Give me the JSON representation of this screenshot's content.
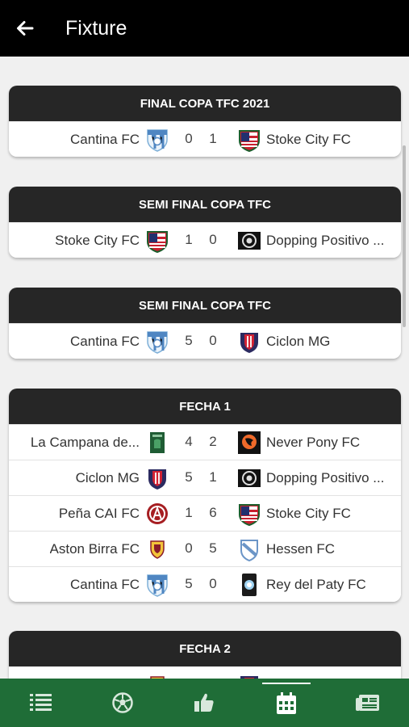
{
  "appbar": {
    "title": "Fixture",
    "back_icon": "arrow-left-icon"
  },
  "nav": [
    {
      "icon": "list-icon"
    },
    {
      "icon": "soccer-ball-icon"
    },
    {
      "icon": "thumbs-up-icon"
    },
    {
      "icon": "calendar-icon",
      "active": true
    },
    {
      "icon": "newspaper-icon"
    }
  ],
  "colors": {
    "appbar": "#000000",
    "header": "#262626",
    "nav": "#1f6d37",
    "background": "#f0f0f0"
  },
  "fixtures": [
    {
      "title": "FINAL COPA TFC 2021",
      "matches": [
        {
          "home": "Cantina FC",
          "home_goals": "0",
          "away_goals": "1",
          "away": "Stoke City FC",
          "home_crest": "cantina-crest",
          "away_crest": "stoke-crest"
        }
      ]
    },
    {
      "title": "SEMI FINAL COPA TFC",
      "matches": [
        {
          "home": "Stoke City FC",
          "home_goals": "1",
          "away_goals": "0",
          "away": "Dopping Positivo ...",
          "home_crest": "stoke-crest",
          "away_crest": "dopping-crest"
        }
      ]
    },
    {
      "title": "SEMI FINAL COPA TFC",
      "matches": [
        {
          "home": "Cantina FC",
          "home_goals": "5",
          "away_goals": "0",
          "away": "Ciclon MG",
          "home_crest": "cantina-crest",
          "away_crest": "ciclon-crest"
        }
      ]
    },
    {
      "title": "FECHA 1",
      "matches": [
        {
          "home": "La Campana de...",
          "home_goals": "4",
          "away_goals": "2",
          "away": "Never Pony FC",
          "home_crest": "campana-crest",
          "away_crest": "neverpony-crest"
        },
        {
          "home": "Ciclon MG",
          "home_goals": "5",
          "away_goals": "1",
          "away": "Dopping Positivo ...",
          "home_crest": "ciclon-crest",
          "away_crest": "dopping-crest"
        },
        {
          "home": "Peña CAI FC",
          "home_goals": "1",
          "away_goals": "6",
          "away": "Stoke City FC",
          "home_crest": "pena-crest",
          "away_crest": "stoke-crest"
        },
        {
          "home": "Aston Birra FC",
          "home_goals": "0",
          "away_goals": "5",
          "away": "Hessen FC",
          "home_crest": "aston-crest",
          "away_crest": "hessen-crest"
        },
        {
          "home": "Cantina FC",
          "home_goals": "5",
          "away_goals": "0",
          "away": "Rey del Paty FC",
          "home_crest": "cantina-crest",
          "away_crest": "rey-crest"
        }
      ]
    },
    {
      "title": "FECHA 2",
      "matches": [
        {
          "home": "",
          "home_goals": "",
          "away_goals": "",
          "away": "",
          "home_crest": "aston-crest",
          "away_crest": "ciclon-crest"
        }
      ]
    }
  ]
}
